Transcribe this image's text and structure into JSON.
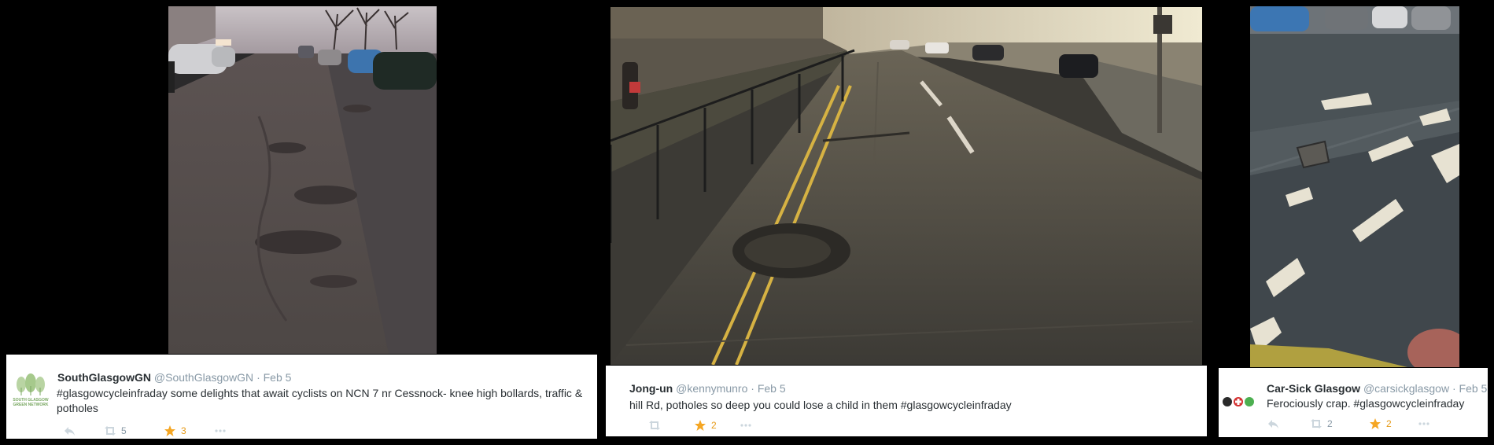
{
  "tweets": [
    {
      "name": "SouthGlasgowGN",
      "handle": "@SouthGlasgowGN",
      "separator": "·",
      "date": "Feb 5",
      "text": "#glasgowcycleinfraday some delights that await cyclists on NCN 7 nr Cessnock- knee high bollards, traffic & potholes",
      "avatar_caption": "SOUTH GLASGOW GREEN NETWORK",
      "retweets": "5",
      "favorites": "3",
      "icons": [
        "reply-icon",
        "retweet-icon",
        "star-icon",
        "more-icon"
      ]
    },
    {
      "name": "Jong-un",
      "handle": "@kennymunro",
      "separator": "·",
      "date": "Feb 5",
      "text": "hill Rd, potholes so deep you could lose a child in them #glasgowcycleinfraday",
      "favorites": "2",
      "icons": [
        "retweet-icon",
        "star-icon",
        "more-icon"
      ]
    },
    {
      "name": "Car-Sick Glasgow",
      "handle": "@carsickglasgow",
      "separator": "·",
      "date": "Feb 5",
      "text": "Ferociously crap. #glasgowcycleinfraday",
      "retweets": "2",
      "favorites": "2",
      "icons": [
        "reply-icon",
        "retweet-icon",
        "star-icon",
        "more-icon"
      ]
    }
  ],
  "colors": {
    "favorite": "#f5a623",
    "muted": "#8899a6",
    "text": "#292f33",
    "background": "#000000"
  }
}
